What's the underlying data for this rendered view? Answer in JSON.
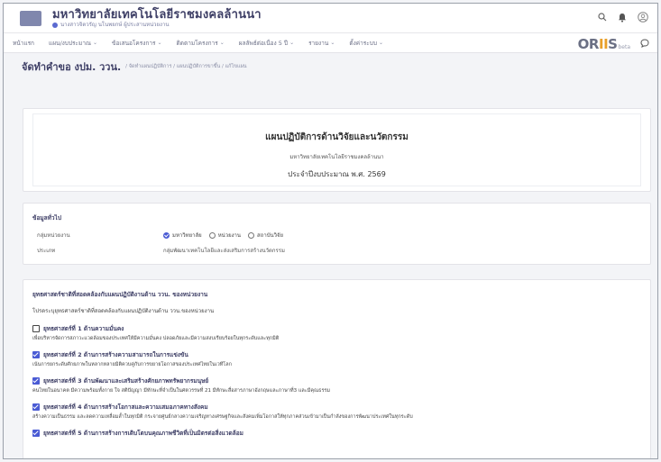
{
  "header": {
    "university_name": "มหาวิทยาลัยเทคโนโลยีราชมงคลล้านนา",
    "user_line": "นางสาวจิตวรัญ นโนพยกษ์ ผู้ประสานหน่วยงาน"
  },
  "nav": {
    "items": [
      {
        "label": "หน้าแรก",
        "dropdown": false
      },
      {
        "label": "แผน/งบประมาณ",
        "dropdown": true
      },
      {
        "label": "ข้อเสนอโครงการ",
        "dropdown": true
      },
      {
        "label": "ติดตามโครงการ",
        "dropdown": true
      },
      {
        "label": "ผลลัพธ์ต่อเนื่อง 5 ปี",
        "dropdown": true
      },
      {
        "label": "รายงาน",
        "dropdown": true
      },
      {
        "label": "ตั้งค่าระบบ",
        "dropdown": true
      }
    ],
    "brand": "ORIIS",
    "brand_suffix": "beta"
  },
  "page": {
    "title": "จัดทำคำขอ งปม. ววน.",
    "breadcrumb": "/ จัดทำแผนปฏิบัติการ / แผนปฏิบัติการขาขึ้น / แก้ไขแผน"
  },
  "plan": {
    "title": "แผนปฏิบัติการด้านวิจัยและนวัตกรรม",
    "org": "มหาวิทยาลัยเทคโนโลยีราชมงคลล้านนา",
    "year": "ประจำปีงบประมาณ พ.ศ. 2569"
  },
  "general": {
    "title": "ข้อมูลทั่วไป",
    "group_label": "กลุ่มหน่วยงาน",
    "group_options": [
      {
        "label": "มหาวิทยาลัย",
        "selected": true
      },
      {
        "label": "หน่วยงาน",
        "selected": false
      },
      {
        "label": "สถาบันวิจัย",
        "selected": false
      }
    ],
    "type_label": "ประเภท",
    "type_value": "กลุ่มพัฒนาเทคโนโลยีและส่งเสริมการสร้างนวัตกรรม"
  },
  "strategy": {
    "title": "ยุทธศาสตร์ชาติที่สอดคล้องกับแผนปฏิบัติงานด้าน ววน. ของหน่วยงาน",
    "desc": "โปรดระบุยุทธศาสตร์ชาติที่สอดคล้องกับแผนปฏิบัติงานด้าน ววน.ของหน่วยงาน",
    "items": [
      {
        "checked": false,
        "title": "ยุทธศาสตร์ที่ 1 ด้านความมั่นคง",
        "desc": "เพื่อบริหารจัดการสภาวะแวดล้อมของประเทศให้มีความมั่นคง ปลอดภัยและมีความสงบเรียบร้อยในทุกระดับและทุกมิติ"
      },
      {
        "checked": true,
        "title": "ยุทธศาสตร์ที่ 2 ด้านการสร้างความสามารถในการแข่งขัน",
        "desc": "เน้นการยกระดับศักยภาพในหลากหลายมิติควบคู่กับการขยายโอกาสของประเทศไทยในเวทีโลก"
      },
      {
        "checked": true,
        "title": "ยุทธศาสตร์ที่ 3 ด้านพัฒนาและเสริมสร้างศักยภาพทรัพยากรมนุษย์",
        "desc": "คนไทยในอนาคต มีความพร้อมทั้งกาย ใจ สติปัญญา มีทักษะที่จำเป็นในศตวรรษที่ 21 มีทักษะสื่อสารภาษาอังกฤษและภาษาที่3 และมีคุณธรรม"
      },
      {
        "checked": true,
        "title": "ยุทธศาสตร์ที่ 4 ด้านการสร้างโอกาสและความเสมอภาคทางสังคม",
        "desc": "สร้างความเป็นธรรม และลดความเหลื่อมล้ำในทุกมิติ กระจายศูนย์กลางความเจริญทางเศรษฐกิจและสังคมเพิ่มโอกาสให้ทุกภาคส่วนเข้ามาเป็นกำลังของการพัฒนาประเทศในทุกระดับ"
      },
      {
        "checked": true,
        "title": "ยุทธศาสตร์ที่ 5 ด้านการสร้างการเติบโตบนคุณภาพชีวิตที่เป็นมิตรต่อสิ่งแวดล้อม",
        "desc": ""
      }
    ]
  }
}
